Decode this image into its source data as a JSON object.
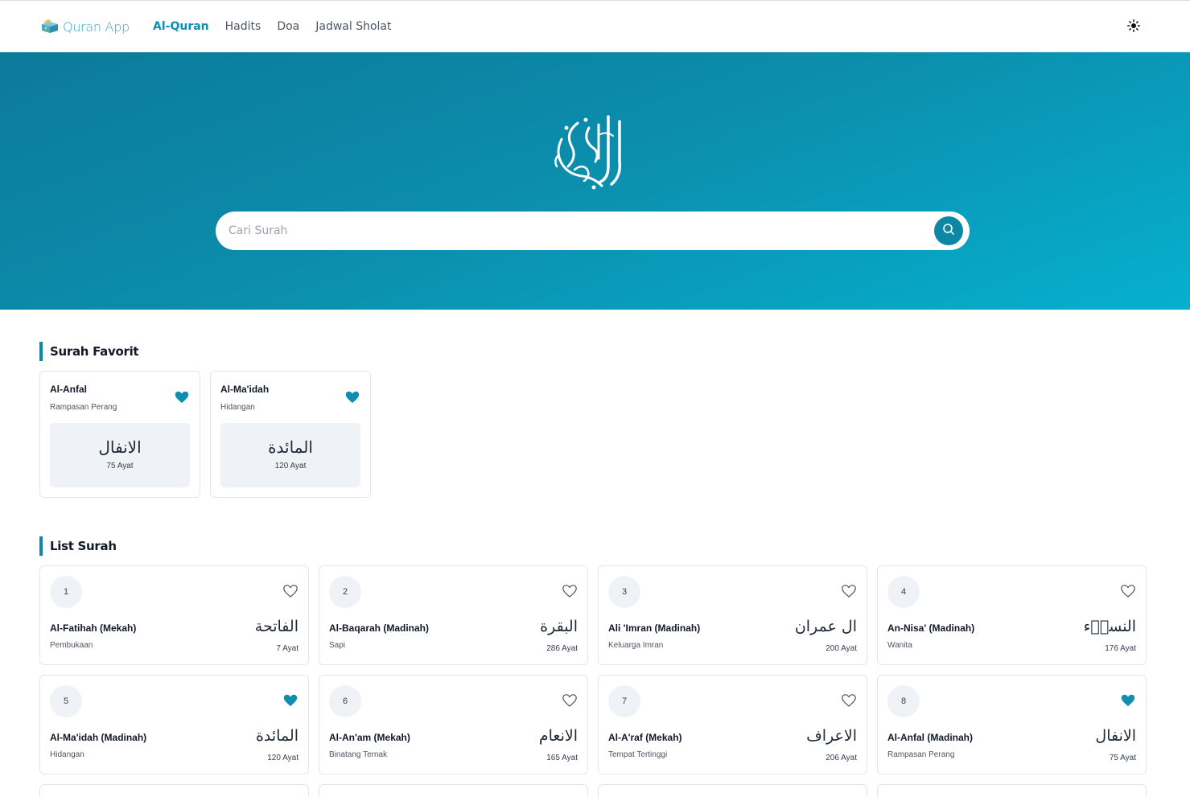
{
  "header": {
    "brand": "Quran App",
    "nav": [
      "Al-Quran",
      "Hadits",
      "Doa",
      "Jadwal Sholat"
    ],
    "active_nav": "Al-Quran"
  },
  "hero": {
    "emblem_text": "القرآن الكريم",
    "search_placeholder": "Cari Surah"
  },
  "favorites": {
    "title": "Surah Favorit",
    "items": [
      {
        "name": "Al-Anfal",
        "meaning": "Rampasan Perang",
        "arabic": "الانفال",
        "ayat": "75 Ayat"
      },
      {
        "name": "Al-Ma'idah",
        "meaning": "Hidangan",
        "arabic": "المائدة",
        "ayat": "120 Ayat"
      }
    ]
  },
  "list": {
    "title": "List Surah",
    "items": [
      {
        "number": "1",
        "name": "Al-Fatihah (Mekah)",
        "meaning": "Pembukaan",
        "arabic": "الفاتحة",
        "ayat": "7 Ayat",
        "favorite": false
      },
      {
        "number": "2",
        "name": "Al-Baqarah (Madinah)",
        "meaning": "Sapi",
        "arabic": "البقرة",
        "ayat": "286 Ayat",
        "favorite": false
      },
      {
        "number": "3",
        "name": "Ali 'Imran (Madinah)",
        "meaning": "Keluarga Imran",
        "arabic": "ال عمران",
        "ayat": "200 Ayat",
        "favorite": false
      },
      {
        "number": "4",
        "name": "An-Nisa' (Madinah)",
        "meaning": "Wanita",
        "arabic": "النساۤء",
        "ayat": "176 Ayat",
        "favorite": false
      },
      {
        "number": "5",
        "name": "Al-Ma'idah (Madinah)",
        "meaning": "Hidangan",
        "arabic": "المائدة",
        "ayat": "120 Ayat",
        "favorite": true
      },
      {
        "number": "6",
        "name": "Al-An'am (Mekah)",
        "meaning": "Binatang Ternak",
        "arabic": "الانعام",
        "ayat": "165 Ayat",
        "favorite": false
      },
      {
        "number": "7",
        "name": "Al-A'raf (Mekah)",
        "meaning": "Tempat Tertinggi",
        "arabic": "الاعراف",
        "ayat": "206 Ayat",
        "favorite": false
      },
      {
        "number": "8",
        "name": "Al-Anfal (Madinah)",
        "meaning": "Rampasan Perang",
        "arabic": "الانفال",
        "ayat": "75 Ayat",
        "favorite": true
      }
    ]
  },
  "colors": {
    "accent": "#0e86a6",
    "hero_start": "#0c7a9b",
    "hero_end": "#06b0cf",
    "heart_filled": "#0e8fb0"
  }
}
